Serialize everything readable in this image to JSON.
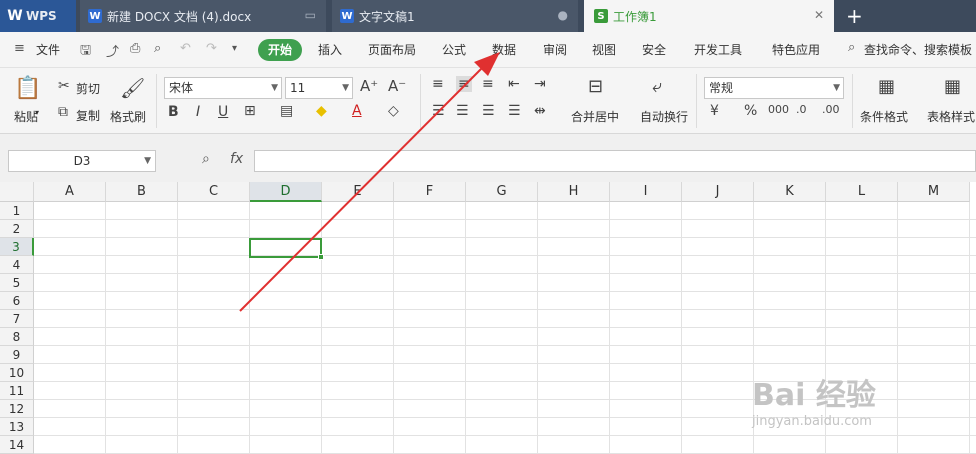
{
  "tabs": {
    "wps": {
      "label": "WPS",
      "icon": "wps-logo-icon"
    },
    "doc1": {
      "label": "新建 DOCX 文档 (4).docx"
    },
    "doc2": {
      "label": "文字文稿1"
    },
    "sheet": {
      "label": "工作簿1"
    },
    "new_tab": "+"
  },
  "menu": {
    "file": "文件",
    "start": "开始",
    "insert": "插入",
    "layout": "页面布局",
    "formula": "公式",
    "data": "数据",
    "review": "审阅",
    "view": "视图",
    "security": "安全",
    "dev": "开发工具",
    "special": "特色应用",
    "search": "查找命令、搜索模板"
  },
  "ribbon": {
    "paste": "粘贴",
    "cut": "剪切",
    "copy": "复制",
    "format_painter": "格式刷",
    "font_name": "宋体",
    "font_size": "11",
    "merge_center": "合并居中",
    "wrap_text": "自动换行",
    "number_format": "常规",
    "cond_format": "条件格式",
    "table_style": "表格样式"
  },
  "formula_bar": {
    "name_box": "D3",
    "fx": "fx"
  },
  "grid": {
    "columns": [
      "A",
      "B",
      "C",
      "D",
      "E",
      "F",
      "G",
      "H",
      "I",
      "J",
      "K",
      "L",
      "M"
    ],
    "rows": [
      "1",
      "2",
      "3",
      "4",
      "5",
      "6",
      "7",
      "8",
      "9",
      "10",
      "11",
      "12",
      "13",
      "14"
    ],
    "selected_column": "D",
    "selected_row": "3"
  },
  "watermark": {
    "main": "Bai 经验",
    "sub": "jingyan.baidu.com"
  },
  "colors": {
    "tabbar": "#3d4a5c",
    "accent_green": "#3a9b3a",
    "arrow_red": "#e03030"
  }
}
